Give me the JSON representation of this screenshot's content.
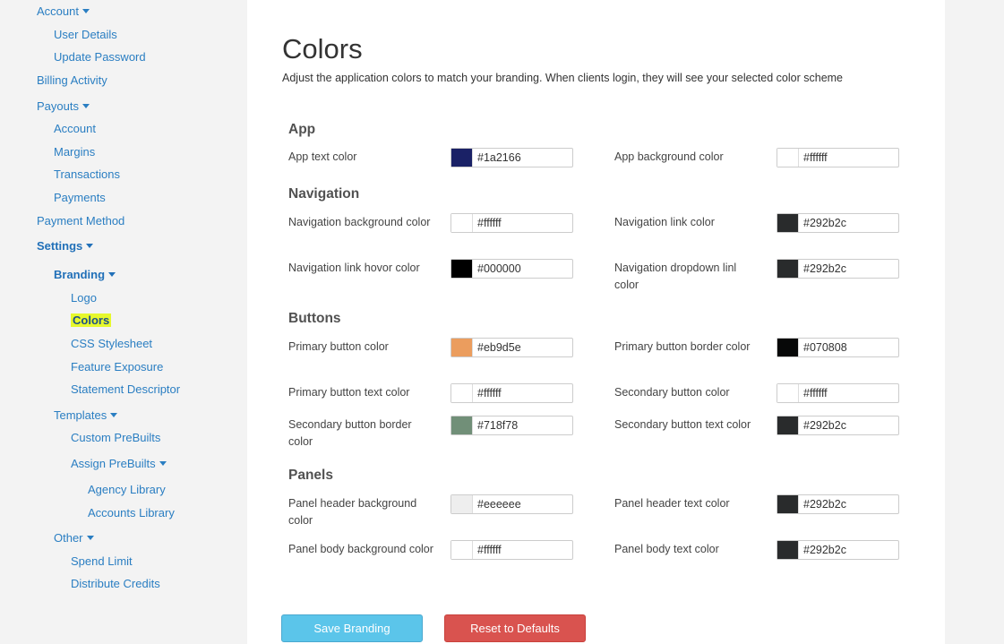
{
  "sidebar": {
    "items": [
      {
        "label": "Account",
        "caret": true,
        "bold": false,
        "active": false
      },
      {
        "label": "User Details",
        "caret": false,
        "bold": false,
        "active": false
      },
      {
        "label": "Update Password",
        "caret": false,
        "bold": false,
        "active": false
      },
      {
        "label": "Billing Activity",
        "caret": false,
        "bold": false,
        "active": false
      },
      {
        "label": "Payouts",
        "caret": true,
        "bold": false,
        "active": false
      },
      {
        "label": "Account",
        "caret": false,
        "bold": false,
        "active": false
      },
      {
        "label": "Margins",
        "caret": false,
        "bold": false,
        "active": false
      },
      {
        "label": "Transactions",
        "caret": false,
        "bold": false,
        "active": false
      },
      {
        "label": "Payments",
        "caret": false,
        "bold": false,
        "active": false
      },
      {
        "label": "Payment Method",
        "caret": false,
        "bold": false,
        "active": false
      },
      {
        "label": "Settings",
        "caret": true,
        "bold": true,
        "active": false
      },
      {
        "label": "Branding",
        "caret": true,
        "bold": true,
        "active": false
      },
      {
        "label": "Logo",
        "caret": false,
        "bold": false,
        "active": false
      },
      {
        "label": "Colors",
        "caret": false,
        "bold": false,
        "active": true
      },
      {
        "label": "CSS Stylesheet",
        "caret": false,
        "bold": false,
        "active": false
      },
      {
        "label": "Feature Exposure",
        "caret": false,
        "bold": false,
        "active": false
      },
      {
        "label": "Statement Descriptor",
        "caret": false,
        "bold": false,
        "active": false
      },
      {
        "label": "Templates",
        "caret": true,
        "bold": false,
        "active": false
      },
      {
        "label": "Custom PreBuilts",
        "caret": false,
        "bold": false,
        "active": false
      },
      {
        "label": "Assign PreBuilts",
        "caret": true,
        "bold": false,
        "active": false
      },
      {
        "label": "Agency Library",
        "caret": false,
        "bold": false,
        "active": false
      },
      {
        "label": "Accounts Library",
        "caret": false,
        "bold": false,
        "active": false
      },
      {
        "label": "Other",
        "caret": true,
        "bold": false,
        "active": false
      },
      {
        "label": "Spend Limit",
        "caret": false,
        "bold": false,
        "active": false
      },
      {
        "label": "Distribute Credits",
        "caret": false,
        "bold": false,
        "active": false
      }
    ]
  },
  "page": {
    "title": "Colors",
    "subtitle": "Adjust the application colors to match your branding. When clients login, they will see your selected color scheme"
  },
  "sections": [
    {
      "title": "App",
      "fields": [
        {
          "label": "App text color",
          "value": "#1a2166",
          "swatch": "#1a2166"
        },
        {
          "label": "App background color",
          "value": "#ffffff",
          "swatch": "#ffffff"
        }
      ]
    },
    {
      "title": "Navigation",
      "fields": [
        {
          "label": "Navigation background color",
          "value": "#ffffff",
          "swatch": "#ffffff"
        },
        {
          "label": "Navigation link color",
          "value": "#292b2c",
          "swatch": "#292b2c"
        },
        {
          "label": "Navigation link hovor color",
          "value": "#000000",
          "swatch": "#000000"
        },
        {
          "label": "Navigation dropdown linl color",
          "value": "#292b2c",
          "swatch": "#292b2c"
        }
      ]
    },
    {
      "title": "Buttons",
      "fields": [
        {
          "label": "Primary button color",
          "value": "#eb9d5e",
          "swatch": "#eb9d5e"
        },
        {
          "label": "Primary button border color",
          "value": "#070808",
          "swatch": "#070808"
        },
        {
          "label": "Primary button text color",
          "value": "#ffffff",
          "swatch": "#ffffff"
        },
        {
          "label": "Secondary button color",
          "value": "#ffffff",
          "swatch": "#ffffff"
        },
        {
          "label": "Secondary button border color",
          "value": "#718f78",
          "swatch": "#718f78"
        },
        {
          "label": "Secondary button text color",
          "value": "#292b2c",
          "swatch": "#292b2c"
        }
      ]
    },
    {
      "title": "Panels",
      "fields": [
        {
          "label": "Panel header background color",
          "value": "#eeeeee",
          "swatch": "#eeeeee"
        },
        {
          "label": "Panel header text color",
          "value": "#292b2c",
          "swatch": "#292b2c"
        },
        {
          "label": "Panel body background color",
          "value": "#ffffff",
          "swatch": "#ffffff"
        },
        {
          "label": "Panel body text color",
          "value": "#292b2c",
          "swatch": "#292b2c"
        }
      ]
    }
  ],
  "actions": {
    "save_label": "Save Branding",
    "reset_label": "Reset to Defaults"
  }
}
